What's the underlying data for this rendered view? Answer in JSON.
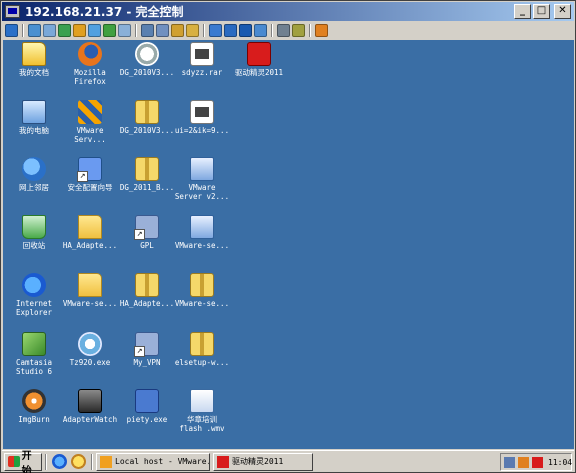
{
  "window": {
    "title": "192.168.21.37 - 完全控制",
    "minimize_label": "_",
    "maximize_label": "□",
    "close_label": "✕"
  },
  "toolbar": {
    "buttons": [
      {
        "icon": "monitor-icon",
        "color": "#2a70c8"
      },
      {
        "icon": "screen-icon",
        "color": "#4a90d0"
      },
      {
        "icon": "mail-icon",
        "color": "#7aa8d8"
      },
      {
        "icon": "chat-icon",
        "color": "#3aa050"
      },
      {
        "icon": "lock-icon",
        "color": "#e0a020"
      },
      {
        "icon": "transfer-icon",
        "color": "#50a0e0"
      },
      {
        "icon": "phone-icon",
        "color": "#40a040"
      },
      {
        "icon": "message-icon",
        "color": "#8ab0d8"
      },
      {
        "icon": "upload-icon",
        "color": "#5a80b0"
      },
      {
        "icon": "network-icon",
        "color": "#7090c0"
      },
      {
        "icon": "disk-icon",
        "color": "#d0a030"
      },
      {
        "icon": "lock2-icon",
        "color": "#d8b040"
      },
      {
        "icon": "window-icon",
        "color": "#3a7ad0"
      },
      {
        "icon": "fullscreen-icon",
        "color": "#2a6ac0"
      },
      {
        "icon": "blue-square-icon",
        "color": "#1a5ab0"
      },
      {
        "icon": "refresh-icon",
        "color": "#4a8ad0"
      },
      {
        "icon": "settings-icon",
        "color": "#708090"
      },
      {
        "icon": "tools-icon",
        "color": "#a0a040"
      },
      {
        "icon": "exit-icon",
        "color": "#e08020"
      }
    ]
  },
  "desktop": {
    "background": "#3a6ea5",
    "icons": [
      {
        "label": "我的文档",
        "icon": "my-documents-icon",
        "style": "i-mydocs",
        "shortcut": false
      },
      {
        "label": "Mozilla\nFirefox",
        "icon": "firefox-icon",
        "style": "i-firefox",
        "shortcut": false
      },
      {
        "label": "DG_2010V3...",
        "icon": "dg-app-icon",
        "style": "i-dg",
        "shortcut": false
      },
      {
        "label": "sdyzz.rar",
        "icon": "rar-file-icon",
        "style": "i-rar",
        "shortcut": false
      },
      {
        "label": "驱动精灵2011",
        "icon": "driver-genius-icon",
        "style": "i-red",
        "shortcut": false
      },
      {
        "label": "我的电脑",
        "icon": "my-computer-icon",
        "style": "i-computer",
        "shortcut": false
      },
      {
        "label": "VMware\nServ...",
        "icon": "vmware-icon",
        "style": "i-vmware",
        "shortcut": false
      },
      {
        "label": "DG_2010V3...",
        "icon": "zip-folder-icon",
        "style": "i-zip",
        "shortcut": false
      },
      {
        "label": "ui=2&ik=9...",
        "icon": "rar-file-icon",
        "style": "i-rar",
        "shortcut": false
      },
      {
        "label": "网上邻居",
        "icon": "network-places-icon",
        "style": "i-net",
        "shortcut": false
      },
      {
        "label": "安全配置向导",
        "icon": "security-wizard-icon",
        "style": "i-wizard",
        "shortcut": true
      },
      {
        "label": "DG_2011_B...",
        "icon": "zip-folder-icon",
        "style": "i-zip",
        "shortcut": false
      },
      {
        "label": "VMware\nServer v2...",
        "icon": "vmware-server-icon",
        "style": "i-vmserver",
        "shortcut": false
      },
      {
        "label": "回收站",
        "icon": "recycle-bin-icon",
        "style": "i-recycle",
        "shortcut": false
      },
      {
        "label": "HA_Adapte...",
        "icon": "folder-icon",
        "style": "i-folder",
        "shortcut": false
      },
      {
        "label": "GPL",
        "icon": "gpl-icon",
        "style": "i-gpl",
        "shortcut": true
      },
      {
        "label": "VMware-se...",
        "icon": "vmware-server-icon",
        "style": "i-vmserver",
        "shortcut": false
      },
      {
        "label": "Internet\nExplorer",
        "icon": "internet-explorer-icon",
        "style": "i-ie",
        "shortcut": false
      },
      {
        "label": "VMware-se...",
        "icon": "folder-icon",
        "style": "i-folder",
        "shortcut": false
      },
      {
        "label": "HA_Adapte...",
        "icon": "zip-folder-icon",
        "style": "i-zip",
        "shortcut": false
      },
      {
        "label": "VMware-se...",
        "icon": "zip-folder-icon",
        "style": "i-zip",
        "shortcut": false
      },
      {
        "label": "Camtasia\nStudio 6",
        "icon": "camtasia-icon",
        "style": "i-camtasia",
        "shortcut": false
      },
      {
        "label": "Tz920.exe",
        "icon": "setup-exe-icon",
        "style": "i-setup",
        "shortcut": false
      },
      {
        "label": "My_VPN",
        "icon": "vpn-icon",
        "style": "i-gpl",
        "shortcut": true
      },
      {
        "label": "elsetup-w...",
        "icon": "zip-folder-icon",
        "style": "i-zip",
        "shortcut": false
      },
      {
        "label": "ImgBurn",
        "icon": "imgburn-icon",
        "style": "i-imgburn",
        "shortcut": false
      },
      {
        "label": "AdapterWatch",
        "icon": "adapter-watch-icon",
        "style": "i-adapter",
        "shortcut": false
      },
      {
        "label": "piety.exe",
        "icon": "network-exe-icon",
        "style": "i-network",
        "shortcut": false
      },
      {
        "label": "华章培训\nflash .wmv",
        "icon": "video-file-icon",
        "style": "i-video",
        "shortcut": false
      }
    ]
  },
  "taskbar": {
    "start_label": "开始",
    "tasks": [
      {
        "label": "Local host - VMware...",
        "icon": "vmware-task-icon",
        "color": "#f0a020"
      },
      {
        "label": "驱动精灵2011",
        "icon": "driver-genius-task-icon",
        "color": "#d81c1c"
      }
    ],
    "tray_icons": [
      {
        "icon": "speaker-icon",
        "color": "#5a7ab0"
      },
      {
        "icon": "vmware-tray-icon",
        "color": "#e08020"
      },
      {
        "icon": "driver-genius-tray-icon",
        "color": "#d81c1c"
      }
    ],
    "clock": "11:04"
  }
}
